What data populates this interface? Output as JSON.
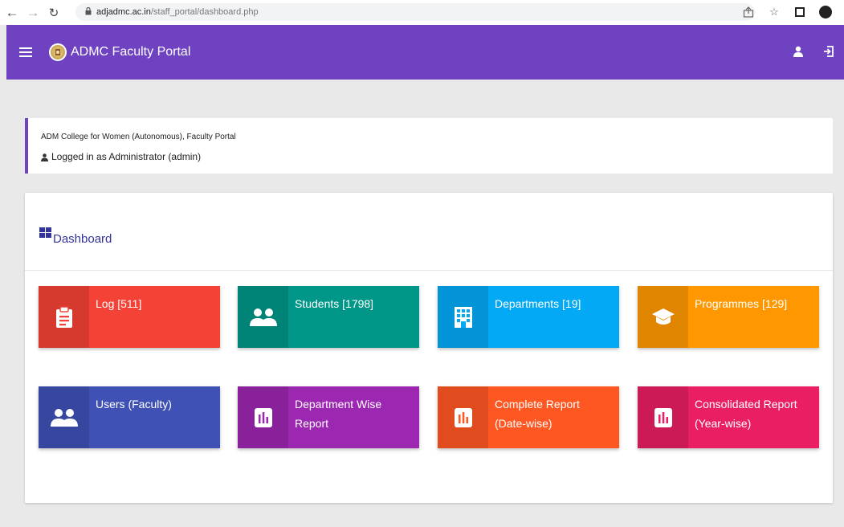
{
  "browser": {
    "url_host": "adjadmc.ac.in",
    "url_path": "/staff_portal/dashboard.php"
  },
  "header": {
    "title": "ADMC Faculty Portal",
    "color": "#6f42c1"
  },
  "info": {
    "college": "ADM College for Women (Autonomous), Faculty Portal",
    "login": "Logged in as Administrator (admin)"
  },
  "dashboard": {
    "heading": "Dashboard",
    "tiles": [
      {
        "label": "Log [511]",
        "color": "#f44336",
        "icon": "clipboard-icon"
      },
      {
        "label": "Students [1798]",
        "color": "#009688",
        "icon": "people-icon"
      },
      {
        "label": "Departments [19]",
        "color": "#03a9f4",
        "icon": "building-icon"
      },
      {
        "label": "Programmes [129]",
        "color": "#ff9800",
        "icon": "graduation-cap-icon"
      },
      {
        "label": "Users (Faculty)",
        "color": "#3f51b5",
        "icon": "people-icon"
      },
      {
        "label": "Department Wise Report",
        "color": "#9c27b0",
        "icon": "bar-chart-icon"
      },
      {
        "label": "Complete Report (Date-wise)",
        "color": "#ff5722",
        "icon": "bar-chart-icon"
      },
      {
        "label": "Consolidated Report (Year-wise)",
        "color": "#e91e63",
        "icon": "bar-chart-icon"
      }
    ]
  }
}
